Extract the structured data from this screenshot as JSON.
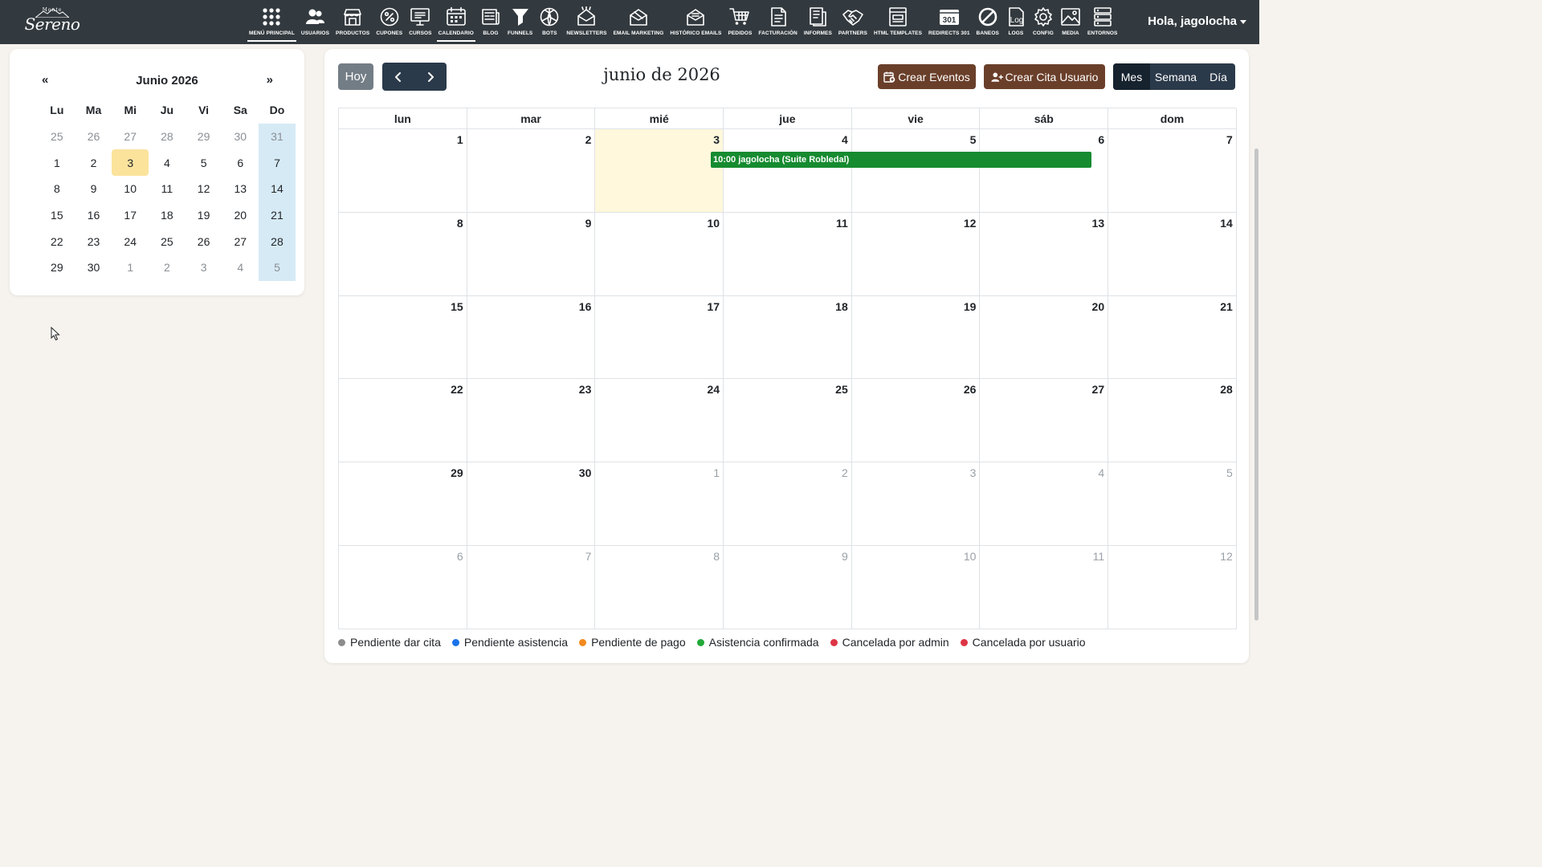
{
  "logo": {
    "top": "Monte",
    "main": "Sereno"
  },
  "nav": [
    {
      "label": "MENÚ PRINCIPAL",
      "icon": "grid-dots-icon",
      "active": true
    },
    {
      "label": "USUARIOS",
      "icon": "users-icon"
    },
    {
      "label": "PRODUCTOS",
      "icon": "store-icon"
    },
    {
      "label": "CUPONES",
      "icon": "percent-badge-icon"
    },
    {
      "label": "CURSOS",
      "icon": "monitor-course-icon"
    },
    {
      "label": "CALENDARIO",
      "icon": "calendar-icon",
      "active": true
    },
    {
      "label": "BLOG",
      "icon": "newspaper-icon"
    },
    {
      "label": "FUNNELS",
      "icon": "funnel-icon"
    },
    {
      "label": "BOTS",
      "icon": "bot-knot-icon"
    },
    {
      "label": "NEWSLETTERS",
      "icon": "newsletter-icon"
    },
    {
      "label": "EMAIL MARKETING",
      "icon": "email-marketing-icon"
    },
    {
      "label": "HISTÓRICO EMAILS",
      "icon": "email-history-icon"
    },
    {
      "label": "PEDIDOS",
      "icon": "cart-icon"
    },
    {
      "label": "FACTURACIÓN",
      "icon": "invoice-icon"
    },
    {
      "label": "INFORMES",
      "icon": "report-icon"
    },
    {
      "label": "PARTNERS",
      "icon": "handshake-icon"
    },
    {
      "label": "HTML TEMPLATES",
      "icon": "template-icon"
    },
    {
      "label": "REDIRECTS 301",
      "icon": "redirect-301-icon"
    },
    {
      "label": "BANEOS",
      "icon": "ban-icon"
    },
    {
      "label": "LOGS",
      "icon": "log-icon"
    },
    {
      "label": "CONFIG",
      "icon": "gear-icon"
    },
    {
      "label": "MEDIA",
      "icon": "image-icon"
    },
    {
      "label": "ENTORNOS",
      "icon": "servers-icon"
    }
  ],
  "user": {
    "greeting": "Hola, jagolocha"
  },
  "mini": {
    "prev": "«",
    "next": "»",
    "title": "Junio 2026",
    "dows": [
      "Lu",
      "Ma",
      "Mi",
      "Ju",
      "Vi",
      "Sa",
      "Do"
    ],
    "weeks": [
      [
        "25",
        "26",
        "27",
        "28",
        "29",
        "30",
        "31"
      ],
      [
        "1",
        "2",
        "3",
        "4",
        "5",
        "6",
        "7"
      ],
      [
        "8",
        "9",
        "10",
        "11",
        "12",
        "13",
        "14"
      ],
      [
        "15",
        "16",
        "17",
        "18",
        "19",
        "20",
        "21"
      ],
      [
        "22",
        "23",
        "24",
        "25",
        "26",
        "27",
        "28"
      ],
      [
        "29",
        "30",
        "1",
        "2",
        "3",
        "4",
        "5"
      ]
    ]
  },
  "toolbar": {
    "today": "Hoy",
    "title": "junio de 2026",
    "create_events": "Crear Eventos",
    "create_appointment": "Crear Cita Usuario",
    "views": [
      "Mes",
      "Semana",
      "Día"
    ],
    "active_view": "Mes"
  },
  "calendar": {
    "dows": [
      "lun",
      "mar",
      "mié",
      "jue",
      "vie",
      "sáb",
      "dom"
    ],
    "weeks": [
      [
        "1",
        "2",
        "3",
        "4",
        "5",
        "6",
        "7"
      ],
      [
        "8",
        "9",
        "10",
        "11",
        "12",
        "13",
        "14"
      ],
      [
        "15",
        "16",
        "17",
        "18",
        "19",
        "20",
        "21"
      ],
      [
        "22",
        "23",
        "24",
        "25",
        "26",
        "27",
        "28"
      ],
      [
        "29",
        "30",
        "1",
        "2",
        "3",
        "4",
        "5"
      ],
      [
        "6",
        "7",
        "8",
        "9",
        "10",
        "11",
        "12"
      ]
    ],
    "today_day": "3",
    "event": {
      "time": "10:00",
      "title": "jagolocha (Suite Robledal)",
      "color": "#168b30"
    }
  },
  "legend": [
    {
      "label": "Pendiente dar cita",
      "color": "#8c8c8c"
    },
    {
      "label": "Pendiente asistencia",
      "color": "#1a73e8"
    },
    {
      "label": "Pendiente de pago",
      "color": "#f28a1e"
    },
    {
      "label": "Asistencia confirmada",
      "color": "#23a83a"
    },
    {
      "label": "Cancelada por admin",
      "color": "#dc3545"
    },
    {
      "label": "Cancelada por usuario",
      "color": "#dc3545"
    }
  ]
}
